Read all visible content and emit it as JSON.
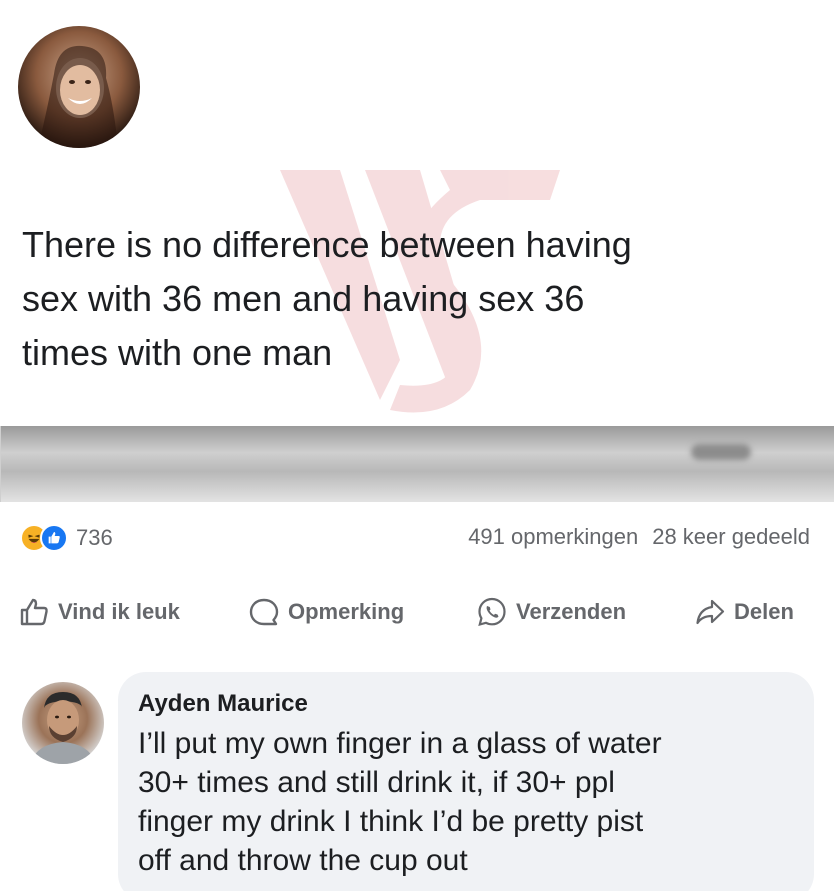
{
  "post": {
    "avatar_icon": "user-photo",
    "text_lines": [
      "There is no difference between having",
      "sex with 36 men and having sex 36",
      "times with one man"
    ],
    "watermark_icon": "watermark-logo"
  },
  "stats": {
    "reactions": [
      "haha-reaction-icon",
      "like-reaction-icon"
    ],
    "reaction_count": "736",
    "comments": "491 opmerkingen",
    "shares": "28 keer gedeeld"
  },
  "actions": {
    "like": "Vind ik leuk",
    "comment": "Opmerking",
    "send": "Verzenden",
    "share": "Delen"
  },
  "comment": {
    "author": "Ayden Maurice",
    "text_lines": [
      "I’ll put my own finger in a glass of water",
      "30+ times and still drink it, if 30+ ppl",
      "finger my drink I think I’d be pretty pist",
      "off and throw the cup out"
    ]
  },
  "colors": {
    "text": "#1c1e21",
    "muted": "#65676b",
    "like_blue": "#1877f2",
    "haha_yellow": "#f7b125",
    "bubble": "#f0f2f5",
    "watermark": "#e8a0a4"
  }
}
